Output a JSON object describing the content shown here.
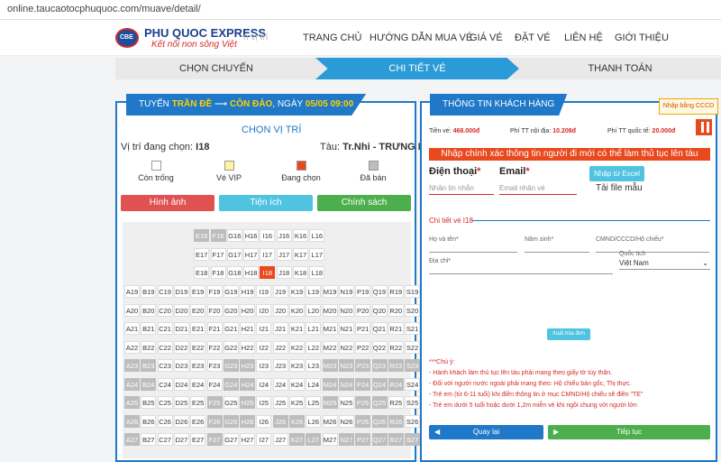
{
  "browser": {
    "url": "online.taucaotocphuquoc.com/muave/detail/"
  },
  "header": {
    "logo_text": "PHU QUOC EXPRESS",
    "logo_slogan": "Kết nối non sông Việt",
    "logo_mark": "CBE",
    "ghost_text": "n vị trí",
    "nav": [
      "TRANG CHỦ",
      "HƯỚNG DẪN MUA VÉ",
      "GIÁ VÉ",
      "ĐẶT VÉ",
      "LIÊN HỆ",
      "GIỚI THIỆU"
    ]
  },
  "steps": [
    "CHỌN CHUYẾN",
    "CHI TIẾT VÉ",
    "THANH TOÁN"
  ],
  "left": {
    "route_prefix": "TUYẾN ",
    "route_from": "TRẦN ĐỀ",
    "route_arrow": " ⟶ ",
    "route_to": "CÔN ĐẢO",
    "route_date_prefix": ", NGÀY ",
    "route_date": "05/05 09:00",
    "title": "CHỌN VỊ TRÍ",
    "current_label": "Vị trí đang chọn: ",
    "current_seat": "I18",
    "ship_label": "Tàu: ",
    "ship_name": "Tr.Nhi - TRƯNG NHỊ",
    "legend": [
      {
        "label": "Còn trống",
        "color": "#ffffff"
      },
      {
        "label": "Vé VIP",
        "color": "#fff59d"
      },
      {
        "label": "Đang chọn",
        "color": "#e8491d"
      },
      {
        "label": "Đã bán",
        "color": "#bdbdbd"
      }
    ],
    "buttons": [
      {
        "label": "Hình ảnh",
        "color": "#e05252"
      },
      {
        "label": "Tiện ích",
        "color": "#4fc3e0"
      },
      {
        "label": "Chính sách",
        "color": "#4cae4c"
      }
    ]
  },
  "right": {
    "title": "THÔNG TIN KHÁCH HÀNG",
    "cccd_button": "Nhập bằng CCCD",
    "fees": [
      {
        "label": "Tiền vé: ",
        "value": "468.000đ"
      },
      {
        "label": "Phí TT nội địa: ",
        "value": "10.208đ"
      },
      {
        "label": "Phí TT quốc tế: ",
        "value": "20.000đ"
      }
    ],
    "warning": "Nhập chính xác thông tin người đi mới có thể làm thủ tục lên tàu",
    "phone_label": "Điện thoại",
    "phone_placeholder": "Nhân tin nhắn",
    "email_label": "Email",
    "email_placeholder": "Email nhân vé",
    "excel_button": "Nhập từ Excel",
    "template_link": "Tải file mẫu",
    "ticket_detail": "Chi tiết vé I18",
    "fields": {
      "name": "Họ và tên*",
      "birth": "Năm sinh*",
      "id": "CMND/CCCD/Hộ chiếu*",
      "address": "Địa chỉ*",
      "nationality_label": "Quốc tịch",
      "nationality_value": "Việt Nam"
    },
    "invoice_button": "Xuất hóa đơn",
    "notes_title": "***Chú ý:",
    "notes": [
      "- Hành khách làm thủ tục lên tàu phải mang theo giấy tờ tùy thân.",
      "- Đối với người nước ngoài phải mang theo: Hộ chiếu bản gốc, Thị thực.",
      "- Trẻ em (từ 6-11 tuổi) khi điền thông tin ở mục CMND/Hộ chiếu sẽ điền \"TE\"",
      "- Trẻ em dưới 5 tuổi hoặc dưới 1,2m miễn vé khi ngồi chung với người lớn"
    ],
    "back_button": "Quay lại",
    "next_button": "Tiếp tục"
  },
  "seats": {
    "top_rows": [
      [
        {
          "c": "E16",
          "s": "sold"
        },
        {
          "c": "F16",
          "s": "sold"
        },
        {
          "c": "G16",
          "s": "free"
        },
        {
          "c": "H16",
          "s": "free"
        },
        {
          "c": "I16",
          "s": "free"
        },
        {
          "c": "J16",
          "s": "free"
        },
        {
          "c": "K16",
          "s": "free"
        },
        {
          "c": "L16",
          "s": "free"
        }
      ],
      [
        {
          "c": "E17",
          "s": "free"
        },
        {
          "c": "F17",
          "s": "free"
        },
        {
          "c": "G17",
          "s": "free"
        },
        {
          "c": "H17",
          "s": "free"
        },
        {
          "c": "I17",
          "s": "free"
        },
        {
          "c": "J17",
          "s": "free"
        },
        {
          "c": "K17",
          "s": "free"
        },
        {
          "c": "L17",
          "s": "free"
        }
      ],
      [
        {
          "c": "E18",
          "s": "free"
        },
        {
          "c": "F18",
          "s": "free"
        },
        {
          "c": "G18",
          "s": "free"
        },
        {
          "c": "H18",
          "s": "free"
        },
        {
          "c": "I18",
          "s": "sel"
        },
        {
          "c": "J18",
          "s": "free"
        },
        {
          "c": "K18",
          "s": "free"
        },
        {
          "c": "L18",
          "s": "free"
        }
      ]
    ],
    "rows": [
      {
        "n": "19",
        "sold": []
      },
      {
        "n": "20",
        "sold": []
      },
      {
        "n": "21",
        "sold": []
      },
      {
        "n": "22",
        "sold": []
      },
      {
        "n": "23",
        "sold": [
          "A",
          "B",
          "G",
          "H",
          "M",
          "N",
          "P",
          "Q",
          "R",
          "S"
        ]
      },
      {
        "n": "24",
        "sold": [
          "A",
          "B",
          "G",
          "H",
          "M",
          "N",
          "P",
          "Q",
          "R"
        ]
      },
      {
        "n": "25",
        "sold": [
          "A",
          "F",
          "H",
          "M",
          "P",
          "Q"
        ]
      },
      {
        "n": "26",
        "sold": [
          "A",
          "F",
          "G",
          "H",
          "J",
          "K",
          "P",
          "Q",
          "R"
        ]
      },
      {
        "n": "27",
        "sold": [
          "A",
          "F",
          "K",
          "L",
          "N",
          "P",
          "Q",
          "R",
          "S"
        ]
      }
    ]
  }
}
